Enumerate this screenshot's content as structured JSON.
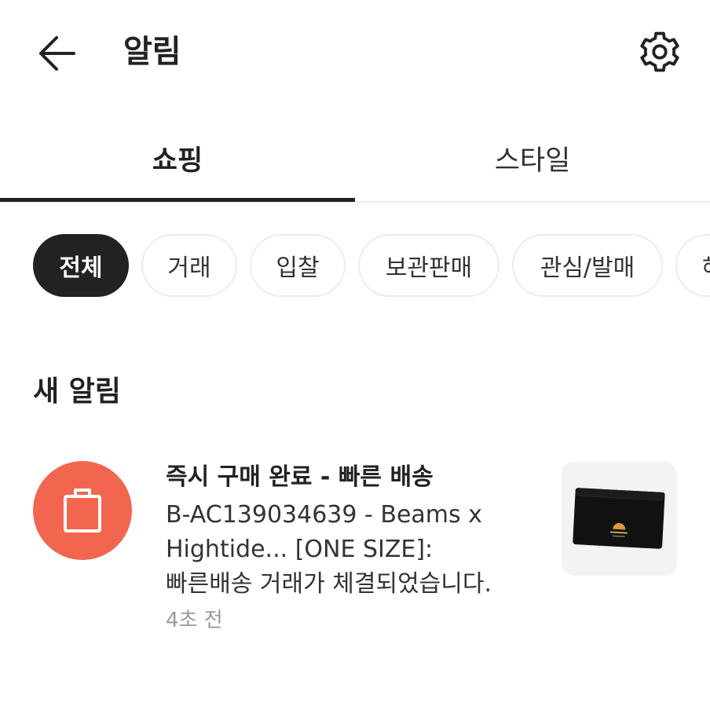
{
  "header": {
    "title": "알림",
    "back_icon": "arrow-left-icon",
    "settings_icon": "gear-icon"
  },
  "tabs": [
    {
      "label": "쇼핑",
      "active": true
    },
    {
      "label": "스타일",
      "active": false
    }
  ],
  "filters": [
    {
      "label": "전체",
      "active": true
    },
    {
      "label": "거래",
      "active": false
    },
    {
      "label": "입찰",
      "active": false
    },
    {
      "label": "보관판매",
      "active": false
    },
    {
      "label": "관심/발매",
      "active": false
    },
    {
      "label": "혜",
      "active": false
    }
  ],
  "section": {
    "title": "새 알림"
  },
  "notification": {
    "icon": "shopping-bag-icon",
    "icon_color": "#f26650",
    "title": "즉시 구매 완료 - 빠른 배송",
    "body_lines": [
      "B-AC139034639 - Beams x",
      "Hightide... [ONE SIZE]:",
      "빠른배송 거래가 체결되었습니다."
    ],
    "time": "4초 전",
    "thumbnail": "black-card-wallet-image"
  }
}
